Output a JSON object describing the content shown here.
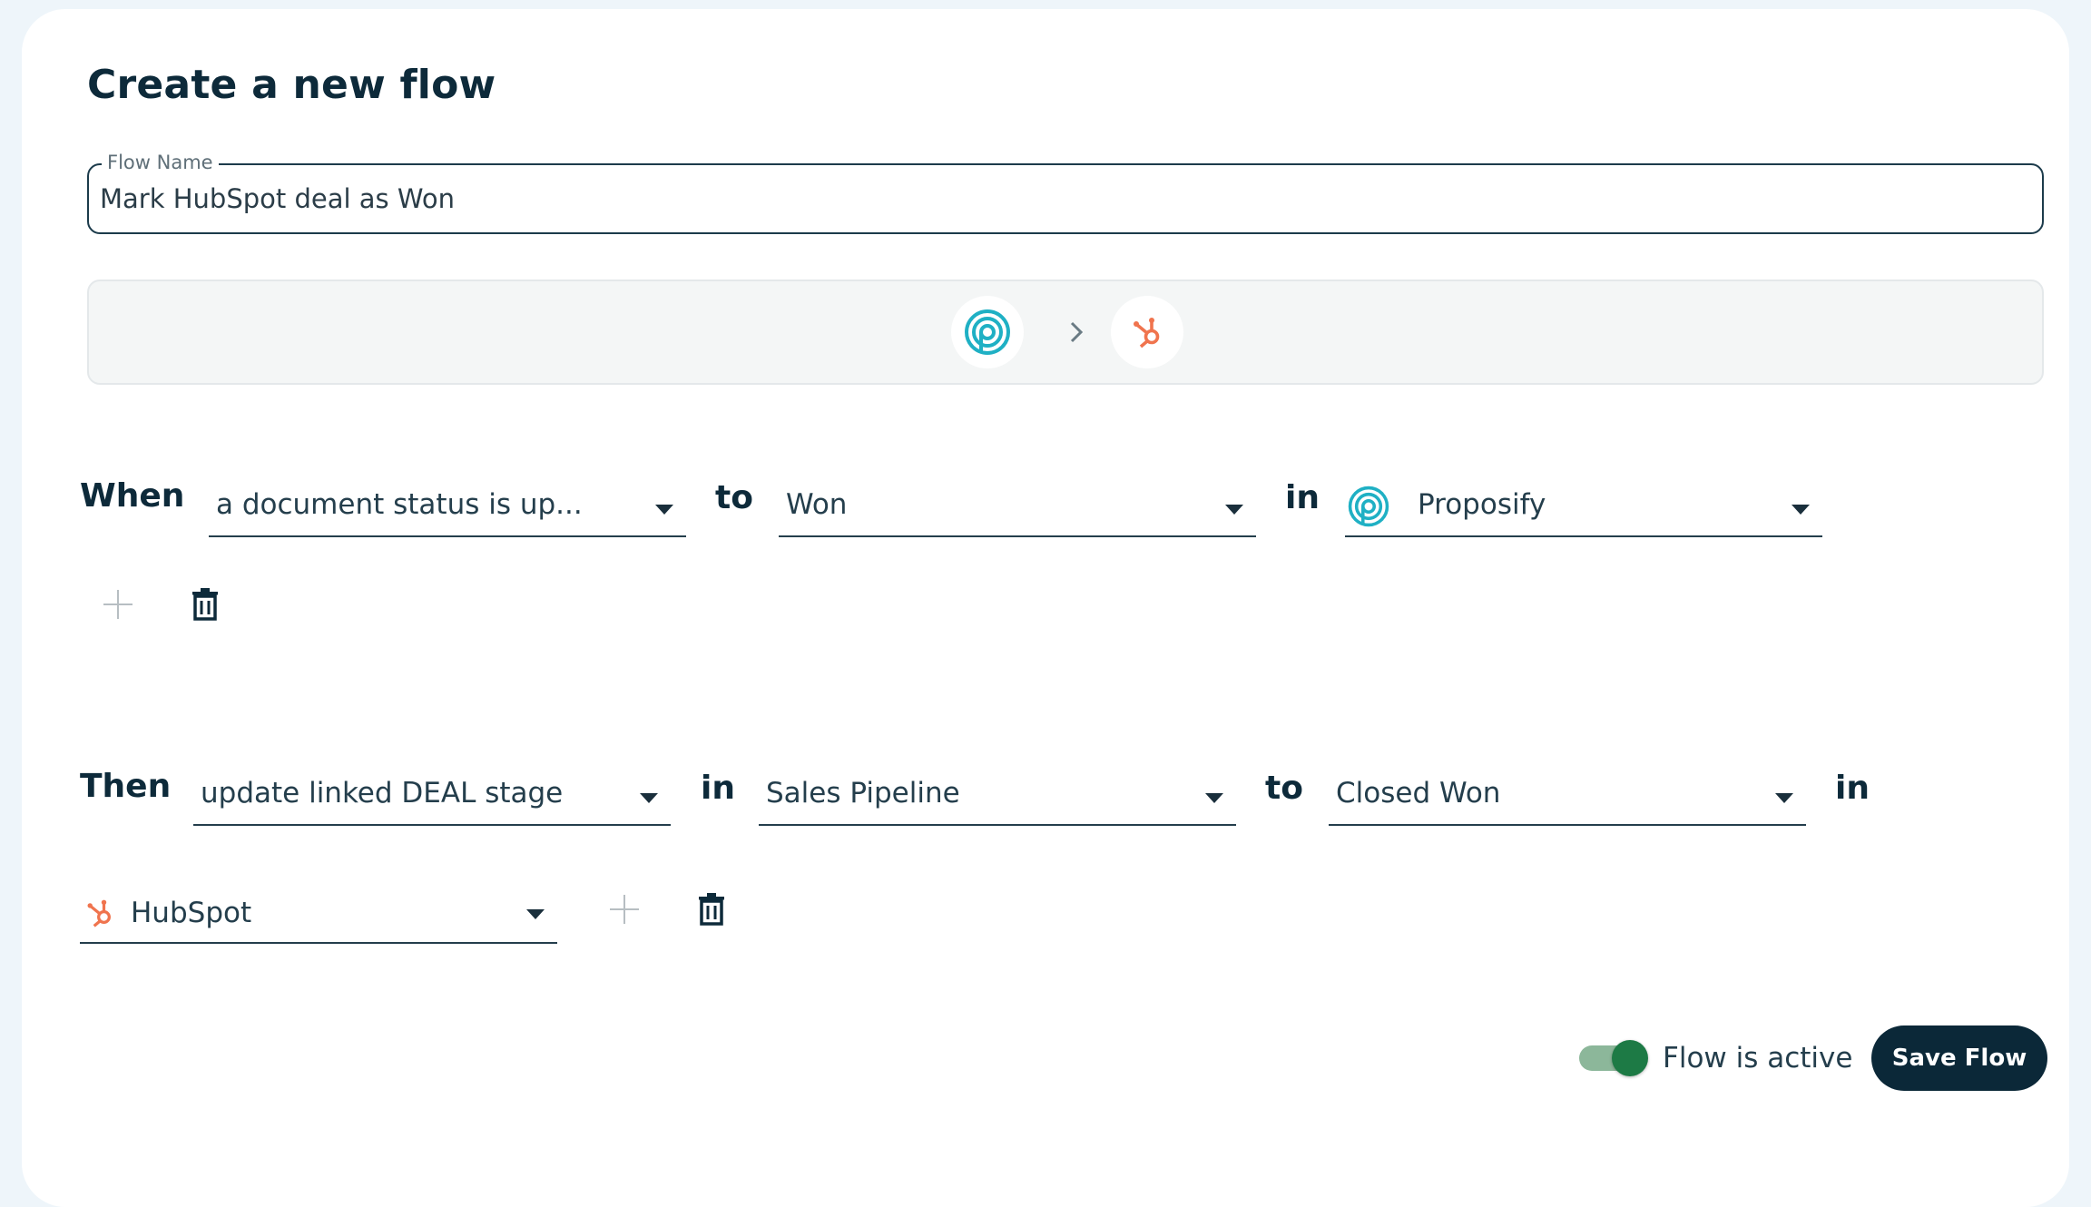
{
  "page": {
    "title": "Create a new flow"
  },
  "flow_name": {
    "label": "Flow Name",
    "value": "Mark HubSpot deal as Won"
  },
  "connector": {
    "source_icon": "proposify-logo-icon",
    "target_icon": "hubspot-logo-icon",
    "arrow_icon": "chevron-right-icon"
  },
  "trigger": {
    "keyword_when": "When",
    "event": "a document status is up...",
    "keyword_to": "to",
    "status": "Won",
    "keyword_in": "in",
    "app": "Proposify"
  },
  "action": {
    "keyword_then": "Then",
    "action": "update linked DEAL stage",
    "keyword_in": "in",
    "pipeline": "Sales Pipeline",
    "keyword_to": "to",
    "stage": "Closed Won",
    "keyword_in2": "in",
    "app": "HubSpot"
  },
  "footer": {
    "toggle_label": "Flow is active",
    "toggle_on": true,
    "save_label": "Save Flow"
  },
  "colors": {
    "proposify": "#1fb0c4",
    "hubspot": "#f0744e",
    "primary": "#0b2838",
    "toggle_on": "#1d7a45"
  }
}
